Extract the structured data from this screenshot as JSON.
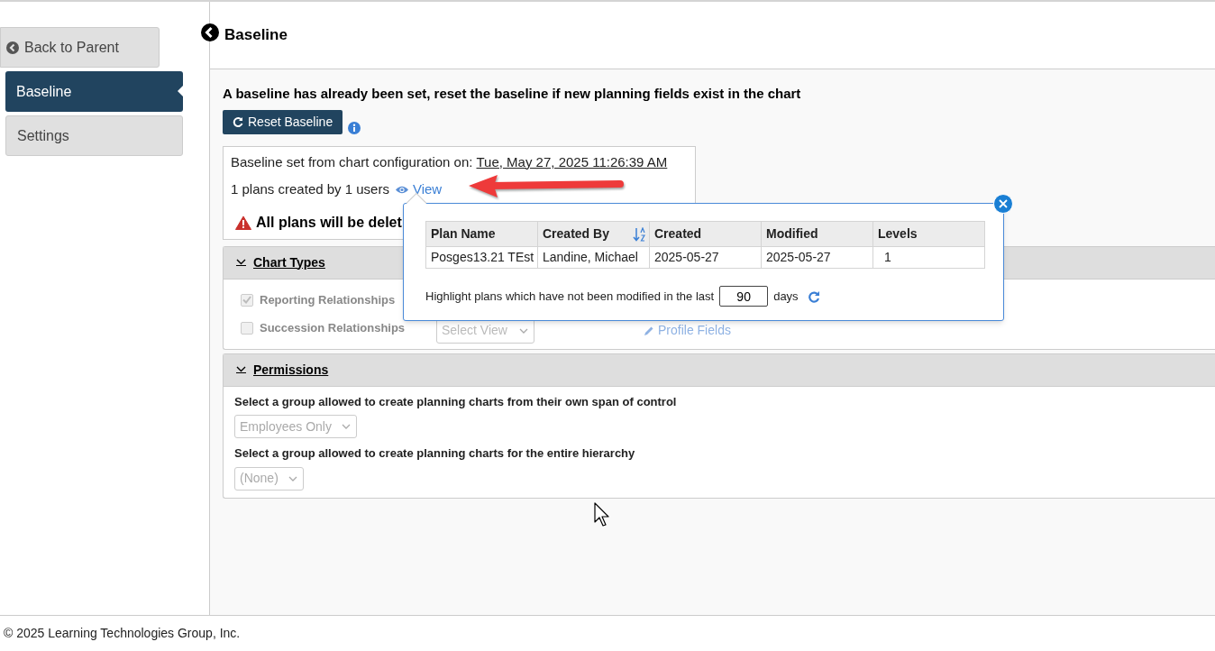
{
  "sidebar": {
    "back_button": "Back to Parent",
    "items": [
      {
        "label": "Baseline",
        "selected": true
      },
      {
        "label": "Settings",
        "selected": false
      }
    ]
  },
  "header": {
    "title": "Baseline"
  },
  "notice": "A baseline has already been set, reset the baseline if new planning fields exist in the chart",
  "reset_button": "Reset Baseline",
  "baseline_info": {
    "set_label": "Baseline set from chart configuration on:",
    "set_date": "Tue, May 27, 2025 11:26:39 AM",
    "plans_text": "1 plans created by 1 users",
    "view_link": "View",
    "warning": "All plans will be delet"
  },
  "plans_popover": {
    "columns": [
      {
        "label": "Plan Name",
        "sorted": false
      },
      {
        "label": "Created By",
        "sorted": true
      },
      {
        "label": "Created",
        "sorted": false
      },
      {
        "label": "Modified",
        "sorted": false
      },
      {
        "label": "Levels",
        "sorted": false
      }
    ],
    "rows": [
      [
        "Posges13.21 TEst",
        "Landine, Michael",
        "2025-05-27",
        "2025-05-27",
        "1"
      ]
    ],
    "highlight_label": "Highlight plans which have not been modified in the last",
    "days_value": "90",
    "days_unit": "days"
  },
  "chart_types": {
    "title": "Chart Types",
    "expanded": true,
    "options": [
      {
        "label": "Reporting Relationships",
        "checked": true
      },
      {
        "label": "Succession Relationships",
        "checked": false,
        "select": "Select View",
        "link": "Profile Fields"
      }
    ]
  },
  "permissions": {
    "title": "Permissions",
    "expanded": true,
    "fields": [
      {
        "label": "Select a group allowed to create planning charts from their own span of control",
        "value": "Employees Only"
      },
      {
        "label": "Select a group allowed to create planning charts for the entire hierarchy",
        "value": "(None)"
      }
    ]
  },
  "footer": "© 2025 Learning Technologies Group, Inc."
}
